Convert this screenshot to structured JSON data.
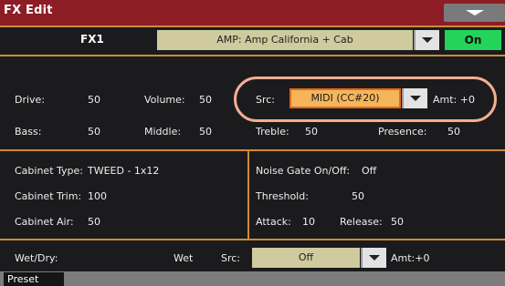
{
  "app": {
    "title": "FX Edit"
  },
  "fx": {
    "slot_label": "FX1",
    "amp_model": "AMP: Amp California + Cab",
    "on_label": "On"
  },
  "amp_params": {
    "drive_label": "Drive:",
    "drive_value": "50",
    "volume_label": "Volume:",
    "volume_value": "50",
    "src_label": "Src:",
    "src_value": "MIDI (CC#20)",
    "amt_label": "Amt: +0",
    "bass_label": "Bass:",
    "bass_value": "50",
    "middle_label": "Middle:",
    "middle_value": "50",
    "treble_label": "Treble:",
    "treble_value": "50",
    "presence_label": "Presence:",
    "presence_value": "50"
  },
  "cabinet": {
    "type_label": "Cabinet Type:",
    "type_value": "TWEED - 1x12",
    "trim_label": "Cabinet Trim:",
    "trim_value": "100",
    "air_label": "Cabinet Air:",
    "air_value": "50"
  },
  "noise_gate": {
    "onoff_label": "Noise Gate On/Off:",
    "onoff_value": "Off",
    "threshold_label": "Threshold:",
    "threshold_value": "50",
    "attack_label": "Attack:",
    "attack_value": "10",
    "release_label": "Release:",
    "release_value": "50"
  },
  "wetdry": {
    "label": "Wet/Dry:",
    "value": "Wet",
    "src_label": "Src:",
    "src_value": "Off",
    "amt_label": "Amt:+0"
  },
  "tabs": {
    "preset": "Preset"
  },
  "colors": {
    "title_bar": "#8c1d25",
    "divider": "#cc8a3b",
    "on_button": "#24d35a",
    "src_selected": "#f5b55a",
    "highlight": "#f3ad92"
  }
}
